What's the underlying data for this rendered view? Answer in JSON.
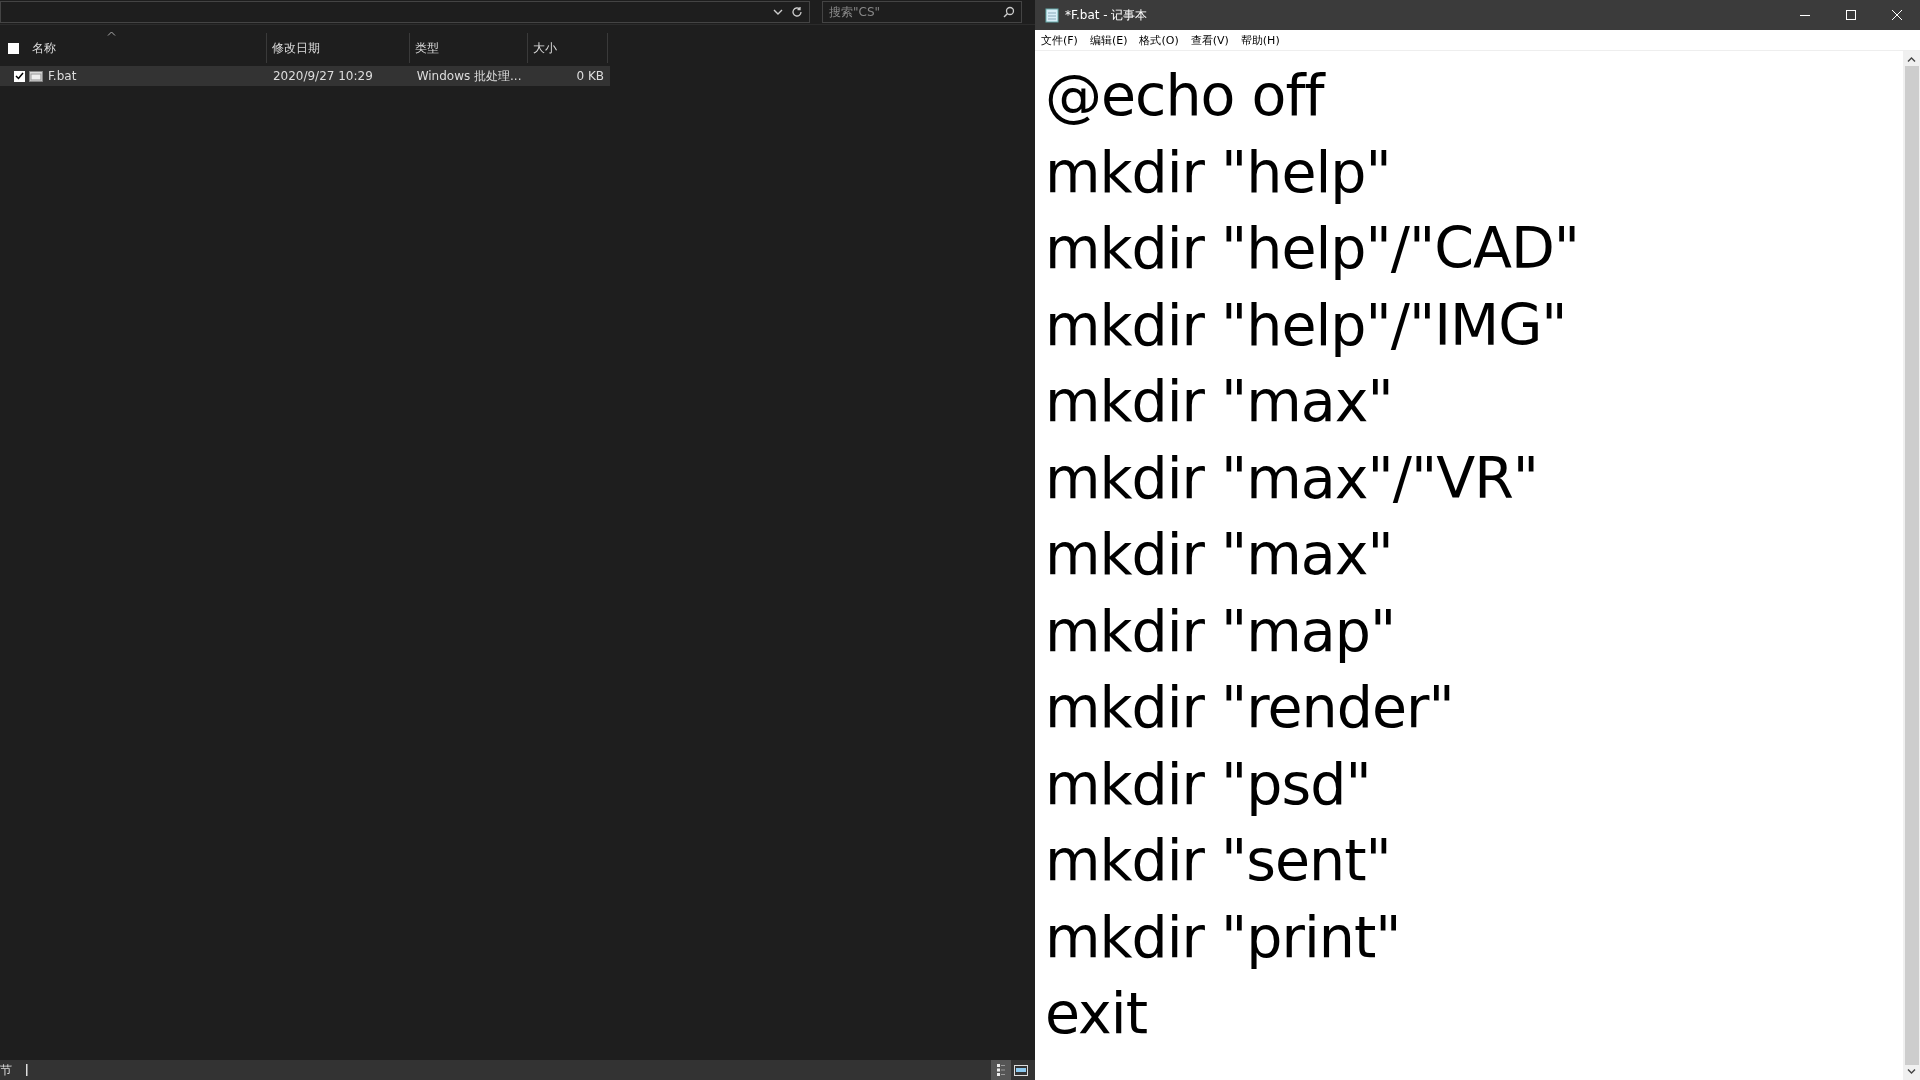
{
  "explorer": {
    "search": {
      "placeholder": "搜索\"CS\""
    },
    "columns": [
      {
        "label": "名称",
        "sorted": true
      },
      {
        "label": "修改日期",
        "sorted": false
      },
      {
        "label": "类型",
        "sorted": false
      },
      {
        "label": "大小",
        "sorted": false
      }
    ],
    "header_checked": false,
    "rows": [
      {
        "name": "F.bat",
        "date": "2020/9/27 10:29",
        "type": "Windows 批处理...",
        "size": "0 KB",
        "checked": true,
        "selected": true
      }
    ],
    "status_bar": {
      "text": "节",
      "views": [
        {
          "kind": "details",
          "selected": true
        },
        {
          "kind": "preview",
          "selected": false
        }
      ]
    }
  },
  "notepad": {
    "title": "*F.bat - 记事本",
    "menu": [
      "文件(F)",
      "编辑(E)",
      "格式(O)",
      "查看(V)",
      "帮助(H)"
    ],
    "lines": [
      "@echo off",
      "mkdir \"help\"",
      "mkdir \"help\"/\"CAD\"",
      "mkdir \"help\"/\"IMG\"",
      "mkdir \"max\"",
      "mkdir \"max\"/\"VR\"",
      "mkdir \"max\"",
      "mkdir \"map\"",
      "mkdir \"render\"",
      "mkdir \"psd\"",
      "mkdir \"sent\"",
      "mkdir \"print\"",
      "exit"
    ]
  }
}
